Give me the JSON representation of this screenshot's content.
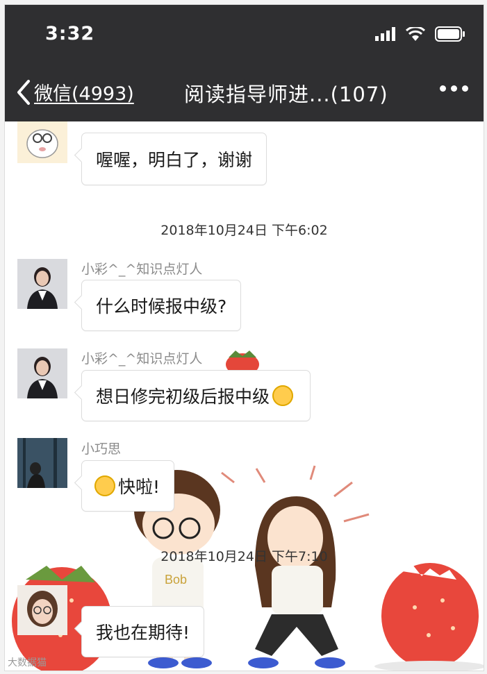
{
  "status": {
    "time": "3:32"
  },
  "nav": {
    "back_label": "微信(4993)",
    "title": "阅读指导师进...(107)"
  },
  "messages": [
    {
      "sender": "",
      "text": "喔喔，明白了，谢谢"
    },
    {
      "sender": "小彩^_^知识点灯人",
      "text": "什么时候报中级?"
    },
    {
      "sender": "小彩^_^知识点灯人",
      "text": "想日修完初级后报中级"
    },
    {
      "sender": "小巧思",
      "text": "快啦!"
    },
    {
      "sender": "",
      "text": "我也在期待!"
    }
  ],
  "timestamps": [
    "2018年10月24日 下午6:02",
    "2018年10月24日 下午7:10"
  ],
  "wallpaper": {
    "shirt_text_left": "Bob"
  },
  "watermark": "大数据猫",
  "icons": [
    "signal-icon",
    "wifi-icon",
    "battery-icon",
    "back-chevron-icon",
    "more-icon",
    "smile-emoji-icon",
    "blush-emoji-icon"
  ],
  "colors": {
    "bar_bg": "#2f2f31",
    "chat_bg": "#ffffff",
    "bubble_border": "#dcdcdc",
    "sender_text": "#8b8b8b"
  }
}
